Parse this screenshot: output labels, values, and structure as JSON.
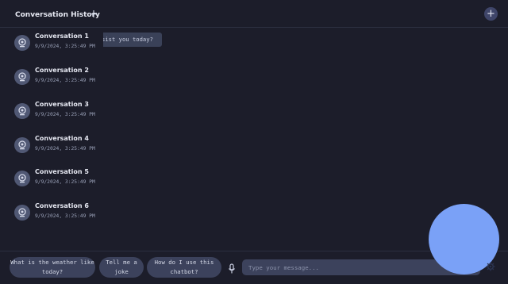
{
  "sidebar": {
    "title": "Conversation History",
    "add_icon": "plus-icon",
    "conversations": [
      {
        "title": "Conversation 1",
        "date": "9/9/2024, 3:25:49 PM"
      },
      {
        "title": "Conversation 2",
        "date": "9/9/2024, 3:25:49 PM"
      },
      {
        "title": "Conversation 3",
        "date": "9/9/2024, 3:25:49 PM"
      },
      {
        "title": "Conversation 4",
        "date": "9/9/2024, 3:25:49 PM"
      },
      {
        "title": "Conversation 5",
        "date": "9/9/2024, 3:25:49 PM"
      },
      {
        "title": "Conversation 6",
        "date": "9/9/2024, 3:25:49 PM"
      }
    ]
  },
  "header": {
    "new_chat_icon": "plus-icon"
  },
  "chat": {
    "visible_message_fragment": "sist you today?"
  },
  "suggestions": [
    "What is the weather like today?",
    "Tell me a joke",
    "How do I use this chatbot?"
  ],
  "composer": {
    "mic_icon": "microphone-icon",
    "placeholder": "Type your message...",
    "settings_icon": "gear-icon"
  },
  "colors": {
    "background": "#1c1d2a",
    "accent": "#7aa1f7",
    "chip": "#3c425c"
  }
}
